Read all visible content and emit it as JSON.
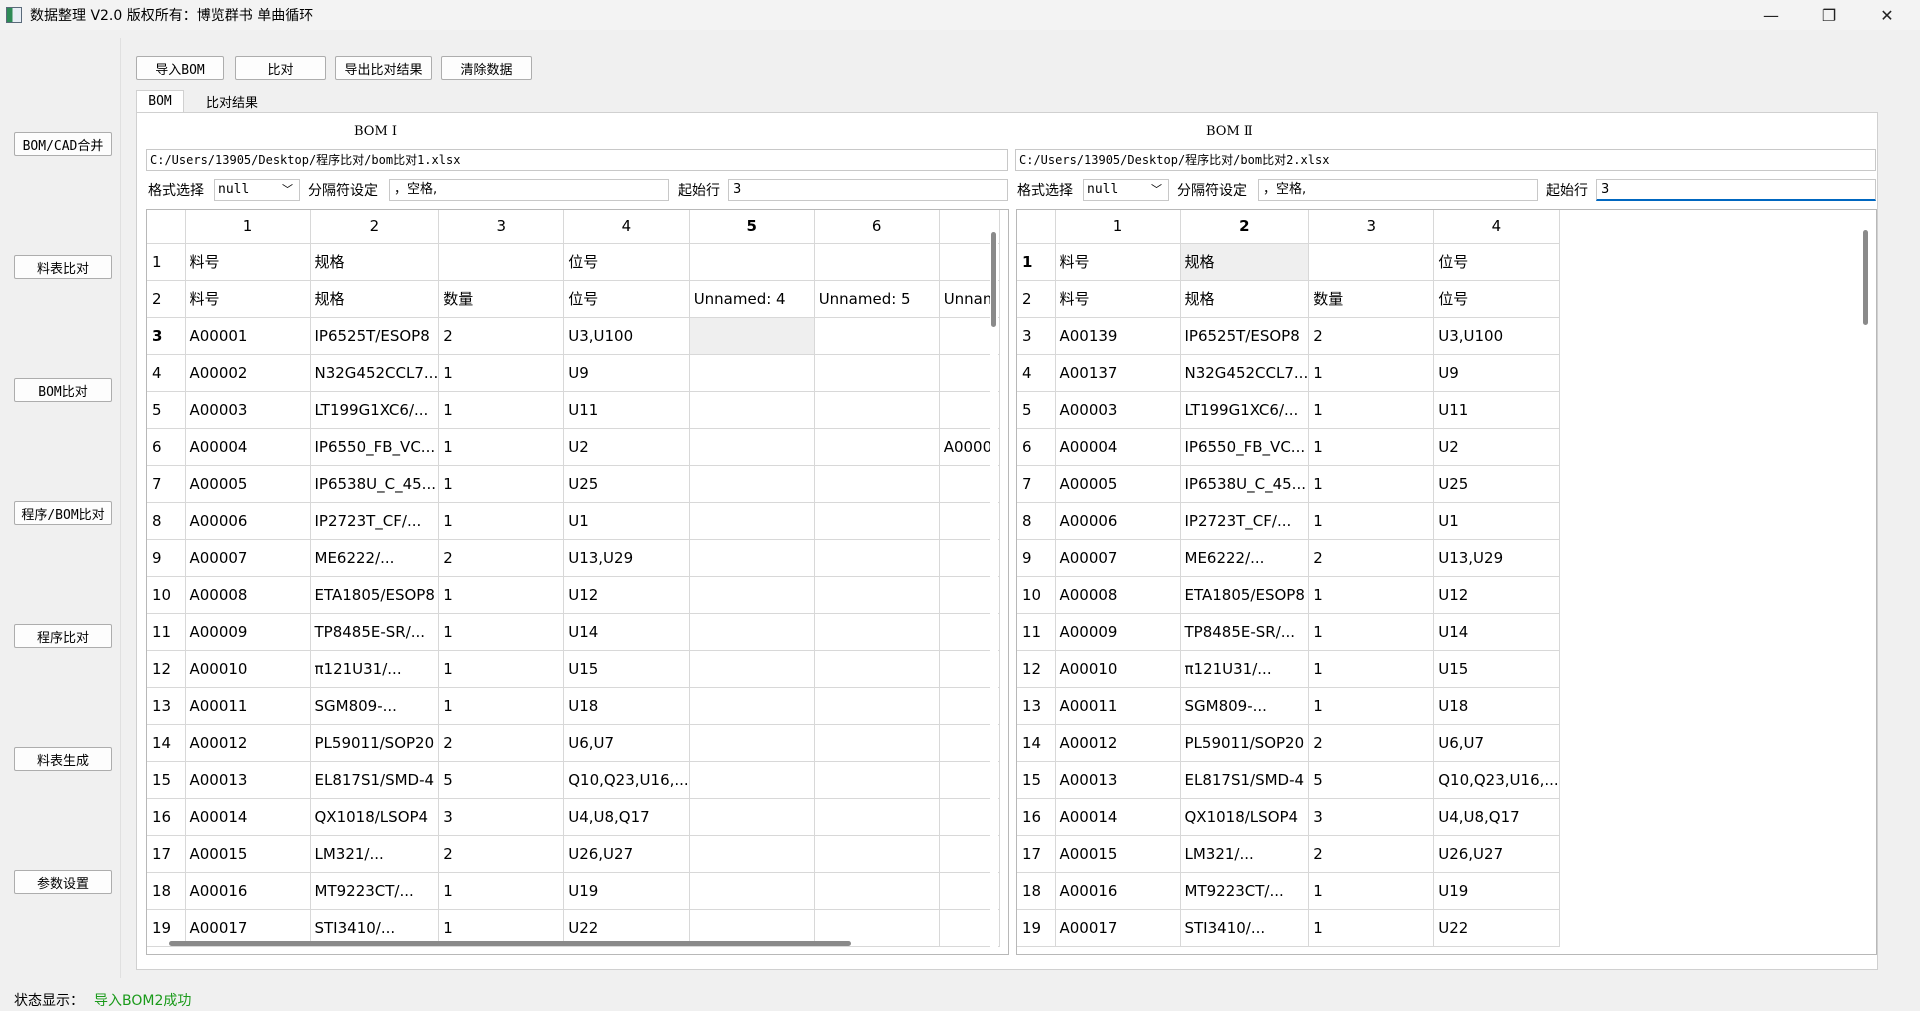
{
  "window": {
    "title": "数据整理 V2.0 版权所有：博览群书 单曲循环",
    "minimize": "—",
    "restore": "❐",
    "close": "✕"
  },
  "sidebar": {
    "items": [
      {
        "label": "BOM/CAD合并"
      },
      {
        "label": "料表比对"
      },
      {
        "label": "BOM比对"
      },
      {
        "label": "程序/BOM比对"
      },
      {
        "label": "程序比对"
      },
      {
        "label": "料表生成"
      },
      {
        "label": "参数设置"
      }
    ]
  },
  "toolbar": {
    "import_label": "导入BOM",
    "compare_label": "比对",
    "export_label": "导出比对结果",
    "clear_label": "清除数据"
  },
  "tabs": [
    {
      "label": "BOM",
      "active": true
    },
    {
      "label": "比对结果",
      "active": false
    }
  ],
  "bom1": {
    "title": "BOM Ⅰ",
    "path": "C:/Users/13905/Desktop/程序比对/bom比对1.xlsx",
    "format_label": "格式选择",
    "format_value": "null",
    "separator_label": "分隔符设定",
    "separator_value": "，空格,",
    "start_row_label": "起始行",
    "start_row_value": "3",
    "col_headers": [
      "1",
      "2",
      "3",
      "4",
      "5",
      "6",
      ""
    ],
    "rows": [
      {
        "n": "1",
        "cells": [
          "料号",
          "规格",
          "",
          "位号",
          "",
          "",
          ""
        ]
      },
      {
        "n": "2",
        "cells": [
          "料号",
          "规格",
          "数量",
          "位号",
          "Unnamed: 4",
          "Unnamed: 5",
          "Unnam"
        ]
      },
      {
        "n": "3",
        "cells": [
          "A00001",
          "IP6525T/ESOP8",
          "2",
          "U3,U100",
          "",
          "",
          ""
        ]
      },
      {
        "n": "4",
        "cells": [
          "A00002",
          "N32G452CCL7...",
          "1",
          "U9",
          "",
          "",
          ""
        ]
      },
      {
        "n": "5",
        "cells": [
          "A00003",
          "LT199G1XC6/...",
          "1",
          "U11",
          "",
          "",
          ""
        ]
      },
      {
        "n": "6",
        "cells": [
          "A00004",
          "IP6550_FB_VC...",
          "1",
          "U2",
          "",
          "",
          "A0000"
        ]
      },
      {
        "n": "7",
        "cells": [
          "A00005",
          "IP6538U_C_45...",
          "1",
          "U25",
          "",
          "",
          ""
        ]
      },
      {
        "n": "8",
        "cells": [
          "A00006",
          "IP2723T_CF/...",
          "1",
          "U1",
          "",
          "",
          ""
        ]
      },
      {
        "n": "9",
        "cells": [
          "A00007",
          "ME6222/...",
          "2",
          "U13,U29",
          "",
          "",
          ""
        ]
      },
      {
        "n": "10",
        "cells": [
          "A00008",
          "ETA1805/ESOP8",
          "1",
          "U12",
          "",
          "",
          ""
        ]
      },
      {
        "n": "11",
        "cells": [
          "A00009",
          "TP8485E-SR/...",
          "1",
          "U14",
          "",
          "",
          ""
        ]
      },
      {
        "n": "12",
        "cells": [
          "A00010",
          "π121U31/...",
          "1",
          "U15",
          "",
          "",
          ""
        ]
      },
      {
        "n": "13",
        "cells": [
          "A00011",
          "SGM809-...",
          "1",
          "U18",
          "",
          "",
          ""
        ]
      },
      {
        "n": "14",
        "cells": [
          "A00012",
          "PL59011/SOP20",
          "2",
          "U6,U7",
          "",
          "",
          ""
        ]
      },
      {
        "n": "15",
        "cells": [
          "A00013",
          "EL817S1/SMD-4",
          "5",
          "Q10,Q23,U16,...",
          "",
          "",
          ""
        ]
      },
      {
        "n": "16",
        "cells": [
          "A00014",
          "QX1018/LSOP4",
          "3",
          "U4,U8,Q17",
          "",
          "",
          ""
        ]
      },
      {
        "n": "17",
        "cells": [
          "A00015",
          "LM321/...",
          "2",
          "U26,U27",
          "",
          "",
          ""
        ]
      },
      {
        "n": "18",
        "cells": [
          "A00016",
          "MT9223CT/...",
          "1",
          "U19",
          "",
          "",
          ""
        ]
      },
      {
        "n": "19",
        "cells": [
          "A00017",
          "STI3410/...",
          "1",
          "U22",
          "",
          "",
          ""
        ]
      }
    ]
  },
  "bom2": {
    "title": "BOM Ⅱ",
    "path": "C:/Users/13905/Desktop/程序比对/bom比对2.xlsx",
    "format_label": "格式选择",
    "format_value": "null",
    "separator_label": "分隔符设定",
    "separator_value": "，空格,",
    "start_row_label": "起始行",
    "start_row_value": "3",
    "col_headers": [
      "1",
      "2",
      "3",
      "4"
    ],
    "rows": [
      {
        "n": "1",
        "cells": [
          "料号",
          "规格",
          "",
          "位号"
        ]
      },
      {
        "n": "2",
        "cells": [
          "料号",
          "规格",
          "数量",
          "位号"
        ]
      },
      {
        "n": "3",
        "cells": [
          "A00139",
          "IP6525T/ESOP8",
          "2",
          "U3,U100"
        ]
      },
      {
        "n": "4",
        "cells": [
          "A00137",
          "N32G452CCL7...",
          "1",
          "U9"
        ]
      },
      {
        "n": "5",
        "cells": [
          "A00003",
          "LT199G1XC6/...",
          "1",
          "U11"
        ]
      },
      {
        "n": "6",
        "cells": [
          "A00004",
          "IP6550_FB_VC...",
          "1",
          "U2"
        ]
      },
      {
        "n": "7",
        "cells": [
          "A00005",
          "IP6538U_C_45...",
          "1",
          "U25"
        ]
      },
      {
        "n": "8",
        "cells": [
          "A00006",
          "IP2723T_CF/...",
          "1",
          "U1"
        ]
      },
      {
        "n": "9",
        "cells": [
          "A00007",
          "ME6222/...",
          "2",
          "U13,U29"
        ]
      },
      {
        "n": "10",
        "cells": [
          "A00008",
          "ETA1805/ESOP8",
          "1",
          "U12"
        ]
      },
      {
        "n": "11",
        "cells": [
          "A00009",
          "TP8485E-SR/...",
          "1",
          "U14"
        ]
      },
      {
        "n": "12",
        "cells": [
          "A00010",
          "π121U31/...",
          "1",
          "U15"
        ]
      },
      {
        "n": "13",
        "cells": [
          "A00011",
          "SGM809-...",
          "1",
          "U18"
        ]
      },
      {
        "n": "14",
        "cells": [
          "A00012",
          "PL59011/SOP20",
          "2",
          "U6,U7"
        ]
      },
      {
        "n": "15",
        "cells": [
          "A00013",
          "EL817S1/SMD-4",
          "5",
          "Q10,Q23,U16,..."
        ]
      },
      {
        "n": "16",
        "cells": [
          "A00014",
          "QX1018/LSOP4",
          "3",
          "U4,U8,Q17"
        ]
      },
      {
        "n": "17",
        "cells": [
          "A00015",
          "LM321/...",
          "2",
          "U26,U27"
        ]
      },
      {
        "n": "18",
        "cells": [
          "A00016",
          "MT9223CT/...",
          "1",
          "U19"
        ]
      },
      {
        "n": "19",
        "cells": [
          "A00017",
          "STI3410/...",
          "1",
          "U22"
        ]
      }
    ]
  },
  "status": {
    "label": "状态显示：",
    "value": "导入BOM2成功"
  }
}
